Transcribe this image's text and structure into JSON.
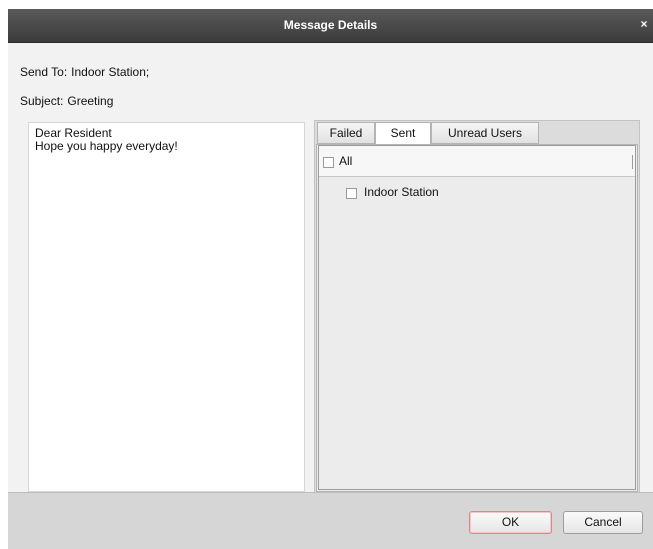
{
  "dialog": {
    "title": "Message Details",
    "close_glyph": "×"
  },
  "fields": {
    "send_to_label": "Send To:",
    "send_to_value": "Indoor Station;",
    "subject_label": "Subject:",
    "subject_value": "Greeting"
  },
  "message": {
    "lines": [
      "Dear Resident",
      "Hope you happy everyday!"
    ]
  },
  "tabs": [
    {
      "label": "Failed",
      "active": false
    },
    {
      "label": "Sent",
      "active": true
    },
    {
      "label": "Unread Users",
      "active": false
    }
  ],
  "recipients": {
    "all_label": "All",
    "items": [
      "Indoor Station"
    ]
  },
  "buttons": {
    "ok": "OK",
    "cancel": "Cancel"
  },
  "colors": {
    "titlebar": "#4a4a4a",
    "dialog_bg": "#f2f2f2",
    "ok_border": "#d58a8a"
  }
}
